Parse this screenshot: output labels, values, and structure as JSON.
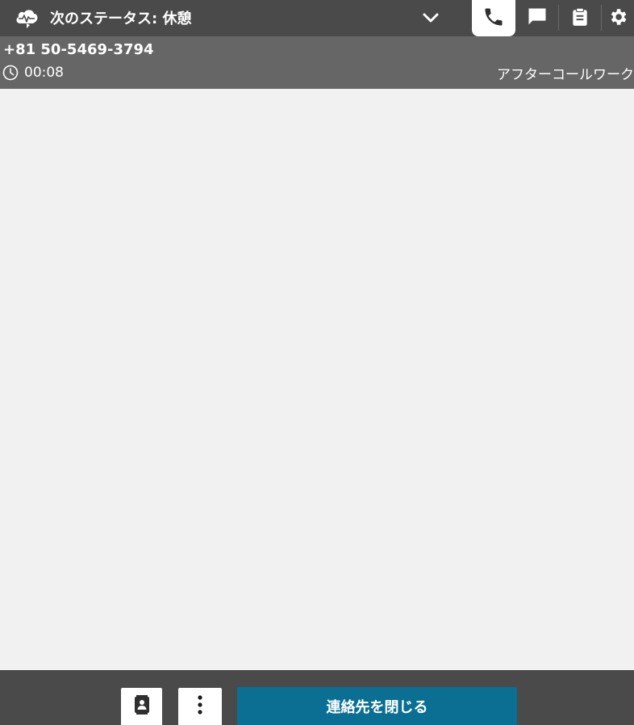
{
  "header": {
    "status_label": "次のステータス: 休憩",
    "icons": {
      "logo": "cloud-heartbeat-icon",
      "dropdown": "chevron-down-icon"
    },
    "tabs": [
      {
        "name": "phone",
        "icon": "phone-icon",
        "active": true
      },
      {
        "name": "chat",
        "icon": "chat-icon",
        "active": false
      },
      {
        "name": "tasks",
        "icon": "clipboard-icon",
        "active": false
      },
      {
        "name": "settings",
        "icon": "gear-icon",
        "active": false
      }
    ]
  },
  "contact": {
    "phone_number": "+81 50-5469-3794",
    "timer": "00:08",
    "state": "アフターコールワーク"
  },
  "footer": {
    "quick_connects_icon": "contact-book-icon",
    "more_icon": "more-vertical-icon",
    "close_contact_label": "連絡先を閉じる"
  },
  "colors": {
    "topbar": "#4a4a4a",
    "contact_bar": "#666666",
    "content_bg": "#f1f1f1",
    "primary_button": "#0a6f92"
  }
}
